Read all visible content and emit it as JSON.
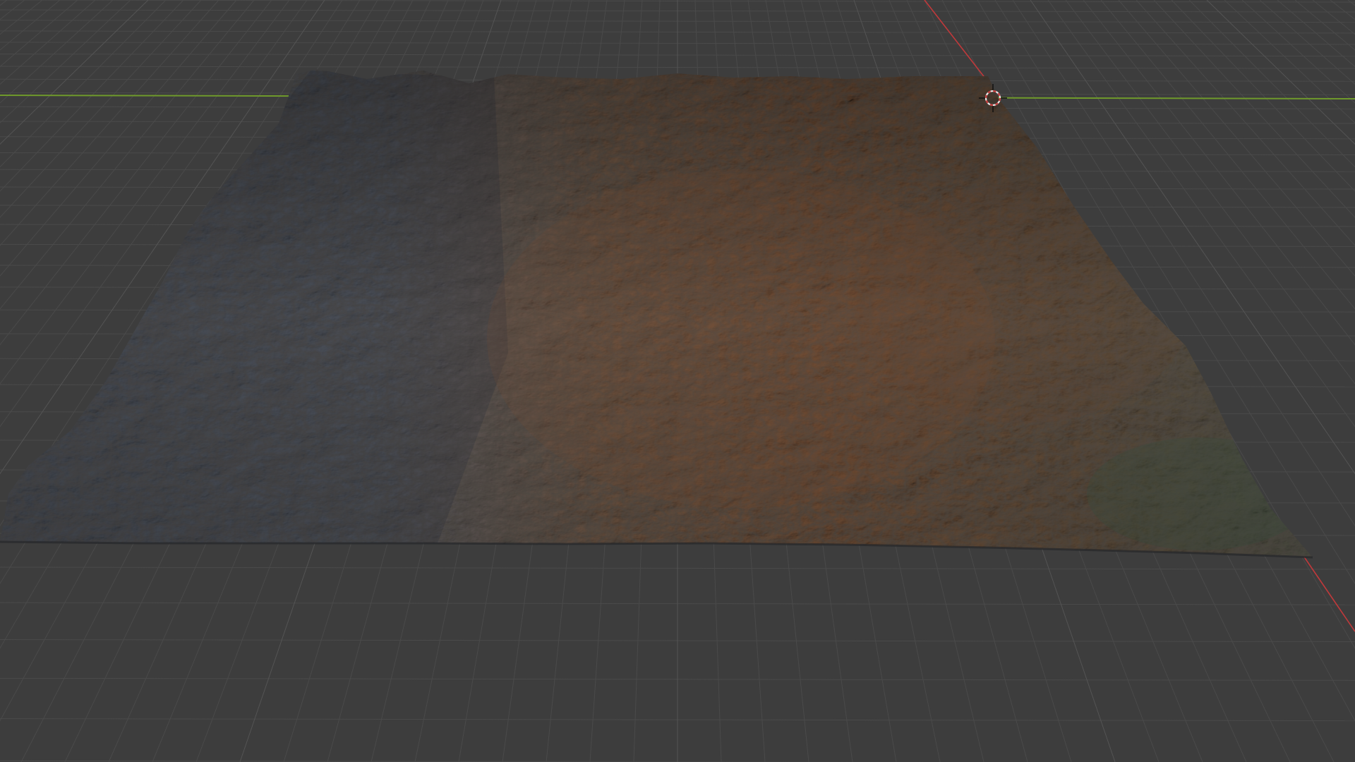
{
  "viewport": {
    "background_color": "#3d3d3d",
    "grid_minor_color": "#4a4a4a",
    "grid_major_color": "#545454",
    "x_axis_color": "#c0393b",
    "y_axis_color": "#6f9a2b"
  },
  "scene": {
    "object": "terrain-mesh",
    "terrain_colors": {
      "mountain_shadow": "#2c3036",
      "mountain_light": "#5f6570",
      "earth_brown": "#6b4a32",
      "earth_dark": "#3f3227",
      "valley_green": "#3e4d3c"
    },
    "cursor_colors": {
      "ring_red": "#c83a3a",
      "ring_white": "#e8e8e8",
      "crosshair": "#111111"
    }
  }
}
